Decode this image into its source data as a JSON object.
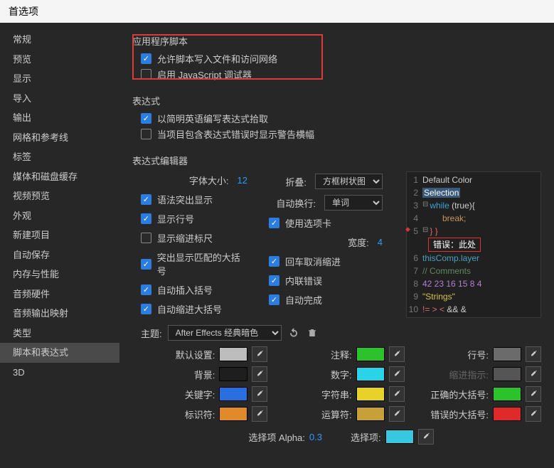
{
  "window": {
    "title": "首选项"
  },
  "sidebar": {
    "items": [
      {
        "label": "常规"
      },
      {
        "label": "预览"
      },
      {
        "label": "显示"
      },
      {
        "label": "导入"
      },
      {
        "label": "输出"
      },
      {
        "label": "网格和参考线"
      },
      {
        "label": "标签"
      },
      {
        "label": "媒体和磁盘缓存"
      },
      {
        "label": "视频预览"
      },
      {
        "label": "外观"
      },
      {
        "label": "新建项目"
      },
      {
        "label": "自动保存"
      },
      {
        "label": "内存与性能"
      },
      {
        "label": "音频硬件"
      },
      {
        "label": "音频输出映射"
      },
      {
        "label": "类型"
      },
      {
        "label": "脚本和表达式"
      },
      {
        "label": "3D"
      }
    ],
    "selected_index": 16
  },
  "app_scripts": {
    "title": "应用程序脚本",
    "allow_write": {
      "label": "允许脚本写入文件和访问网络",
      "checked": true
    },
    "enable_debugger": {
      "label": "启用 JavaScript 调试器",
      "checked": false
    }
  },
  "expressions": {
    "title": "表达式",
    "pick_english": {
      "label": "以简明英语编写表达式拾取",
      "checked": true
    },
    "show_banner": {
      "label": "当项目包含表达式错误时显示警告横幅",
      "checked": false
    }
  },
  "editor": {
    "title": "表达式编辑器",
    "font_size": {
      "label": "字体大小:",
      "value": "12"
    },
    "fold": {
      "label": "折叠:",
      "value": "方框树状图"
    },
    "wrap": {
      "label": "自动换行:",
      "value": "单词"
    },
    "syntax_hl": {
      "label": "语法突出显示",
      "checked": true
    },
    "show_line_no": {
      "label": "显示行号",
      "checked": true
    },
    "show_indent_rule": {
      "label": "显示缩进标尺",
      "checked": false
    },
    "hl_brace": {
      "label": "突出显示匹配的大括号",
      "checked": true
    },
    "auto_bracket": {
      "label": "自动插入括号",
      "checked": true
    },
    "auto_indent_brace": {
      "label": "自动缩进大括号",
      "checked": true
    },
    "use_tabs": {
      "label": "使用选项卡",
      "checked": true
    },
    "width": {
      "label": "宽度:",
      "value": "4"
    },
    "unindent_return": {
      "label": "回车取消缩进",
      "checked": true
    },
    "inline_err": {
      "label": "内联错误",
      "checked": true
    },
    "autocomplete": {
      "label": "自动完成",
      "checked": true
    }
  },
  "code": {
    "l1": "Default Color",
    "l2": "Selection",
    "l3a": "while ",
    "l3b": "(true){",
    "l4": "break;",
    "l5": "} }",
    "err": "错误：此处",
    "l6": "thisComp.layer",
    "l7": "// Comments",
    "l8": "42 23 16 15 8 4",
    "l9": "\"Strings\"",
    "l10a": "!= > < ",
    "l10b": "&& &"
  },
  "theme": {
    "label": "主题:",
    "value": "After Effects 经典暗色",
    "colors": {
      "default": {
        "label": "默认设置:",
        "hex": "#bdbdbd"
      },
      "comment": {
        "label": "注释:",
        "hex": "#2cc22c"
      },
      "lineno": {
        "label": "行号:",
        "hex": "#6b6b6b"
      },
      "background": {
        "label": "背景:",
        "hex": "#1e1e1e"
      },
      "number": {
        "label": "数字:",
        "hex": "#2ad3e8"
      },
      "indent": {
        "label": "缩进指示:",
        "hex": "#555555"
      },
      "keyword": {
        "label": "关键字:",
        "hex": "#2a6fe0"
      },
      "string": {
        "label": "字符串:",
        "hex": "#e8d22a"
      },
      "brace_ok": {
        "label": "正确的大括号:",
        "hex": "#2cc22c"
      },
      "identifier": {
        "label": "标识符:",
        "hex": "#e08a2a"
      },
      "operator": {
        "label": "运算符:",
        "hex": "#c8a03a"
      },
      "brace_err": {
        "label": "错误的大括号:",
        "hex": "#e02a2a"
      }
    },
    "alpha": {
      "label": "选择项 Alpha:",
      "value": "0.3"
    },
    "selection": {
      "label": "选择项:",
      "hex": "#37c7e0"
    }
  }
}
